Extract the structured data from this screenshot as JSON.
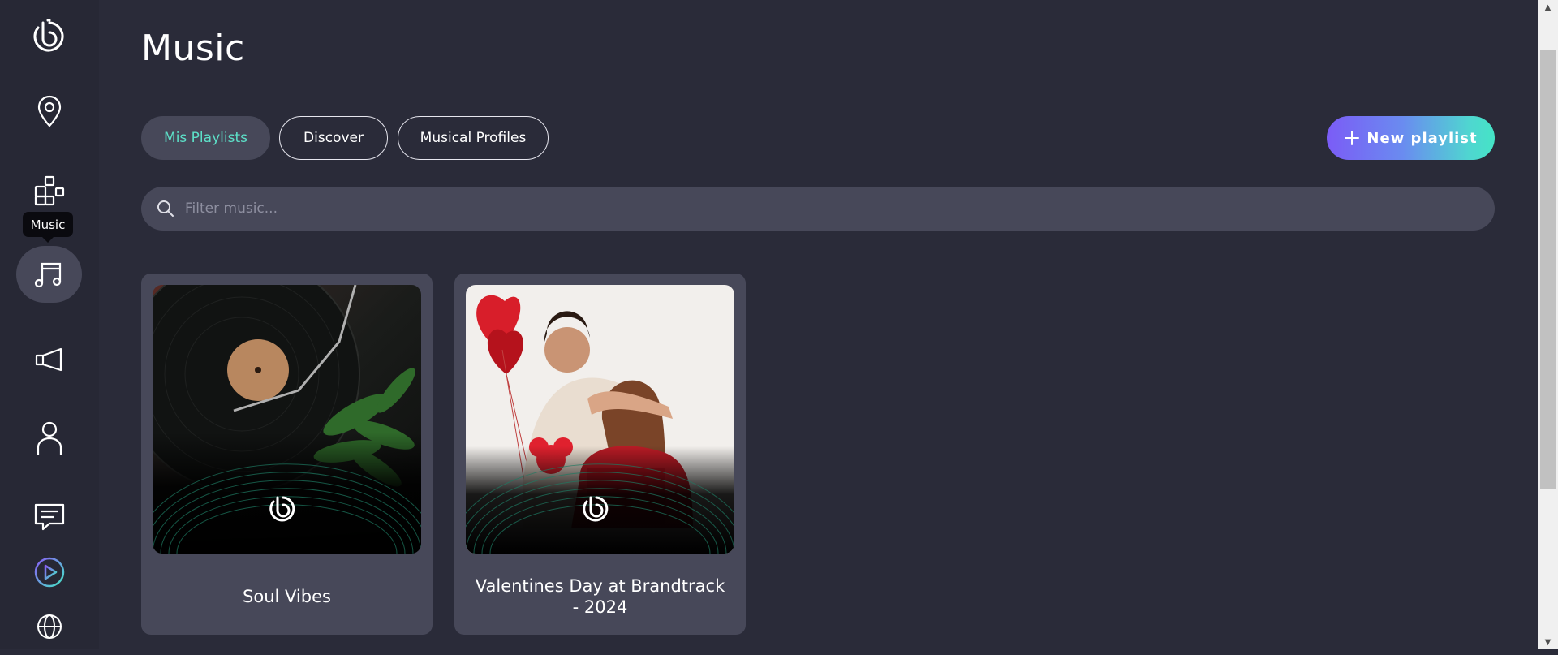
{
  "app": {
    "page_title": "Music"
  },
  "sidebar": {
    "tooltip": "Music",
    "items": [
      {
        "icon": "brand-logo-icon"
      },
      {
        "icon": "location-pin-icon"
      },
      {
        "icon": "widgets-icon"
      },
      {
        "icon": "music-note-icon",
        "active": true
      },
      {
        "icon": "megaphone-icon"
      },
      {
        "icon": "user-icon"
      },
      {
        "icon": "chat-icon"
      },
      {
        "icon": "play-circle-icon"
      },
      {
        "icon": "globe-icon"
      }
    ]
  },
  "tabs": [
    {
      "label": "Mis Playlists",
      "active": true
    },
    {
      "label": "Discover",
      "active": false
    },
    {
      "label": "Musical Profiles",
      "active": false
    }
  ],
  "actions": {
    "new_playlist_label": "New playlist",
    "new_playlist_icon": "plus-icon"
  },
  "search": {
    "placeholder": "Filter music...",
    "value": ""
  },
  "playlists": [
    {
      "title": "Soul Vibes",
      "image": "vinyl-record-photo"
    },
    {
      "title": "Valentines Day at Brandtrack - 2024",
      "image": "couple-valentines-photo"
    }
  ],
  "colors": {
    "background": "#2a2b39",
    "sidebar": "#272835",
    "surface": "#474859",
    "accent_teal": "#5de0c8",
    "gradient_start": "#7b5cf6",
    "gradient_end": "#45e4c6"
  }
}
